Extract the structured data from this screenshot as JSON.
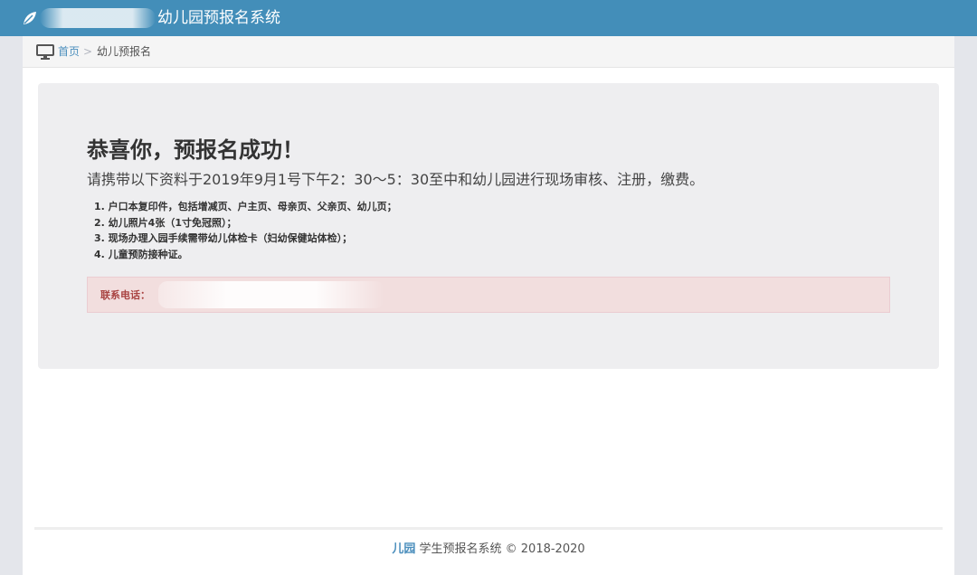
{
  "navbar": {
    "icon": "leaf-icon",
    "title": "幼儿园预报名系统",
    "bg_color": "#438eb9"
  },
  "breadcrumb": {
    "icon": "desktop-icon",
    "home": "首页",
    "separator": ">",
    "current": "幼儿预报名"
  },
  "main": {
    "headline": "恭喜你，预报名成功！",
    "lead": "请携带以下资料于2019年9月1号下午2：30～5：30至中和幼儿园进行现场审核、注册，缴费。",
    "requirements": [
      "1. 户口本复印件，包括增减页、户主页、母亲页、父亲页、幼儿页；",
      "2. 幼儿照片4张（1寸免冠照）；",
      "3. 现场办理入园手续需带幼儿体检卡（妇幼保健站体检）；",
      "4. 儿童预防接种证。"
    ],
    "alert": {
      "label": "联系电话：",
      "bg_color": "#f2dede",
      "text_color": "#a94442"
    }
  },
  "footer": {
    "logo": "儿园",
    "text": "学生预报名系统 © 2018-2020"
  }
}
